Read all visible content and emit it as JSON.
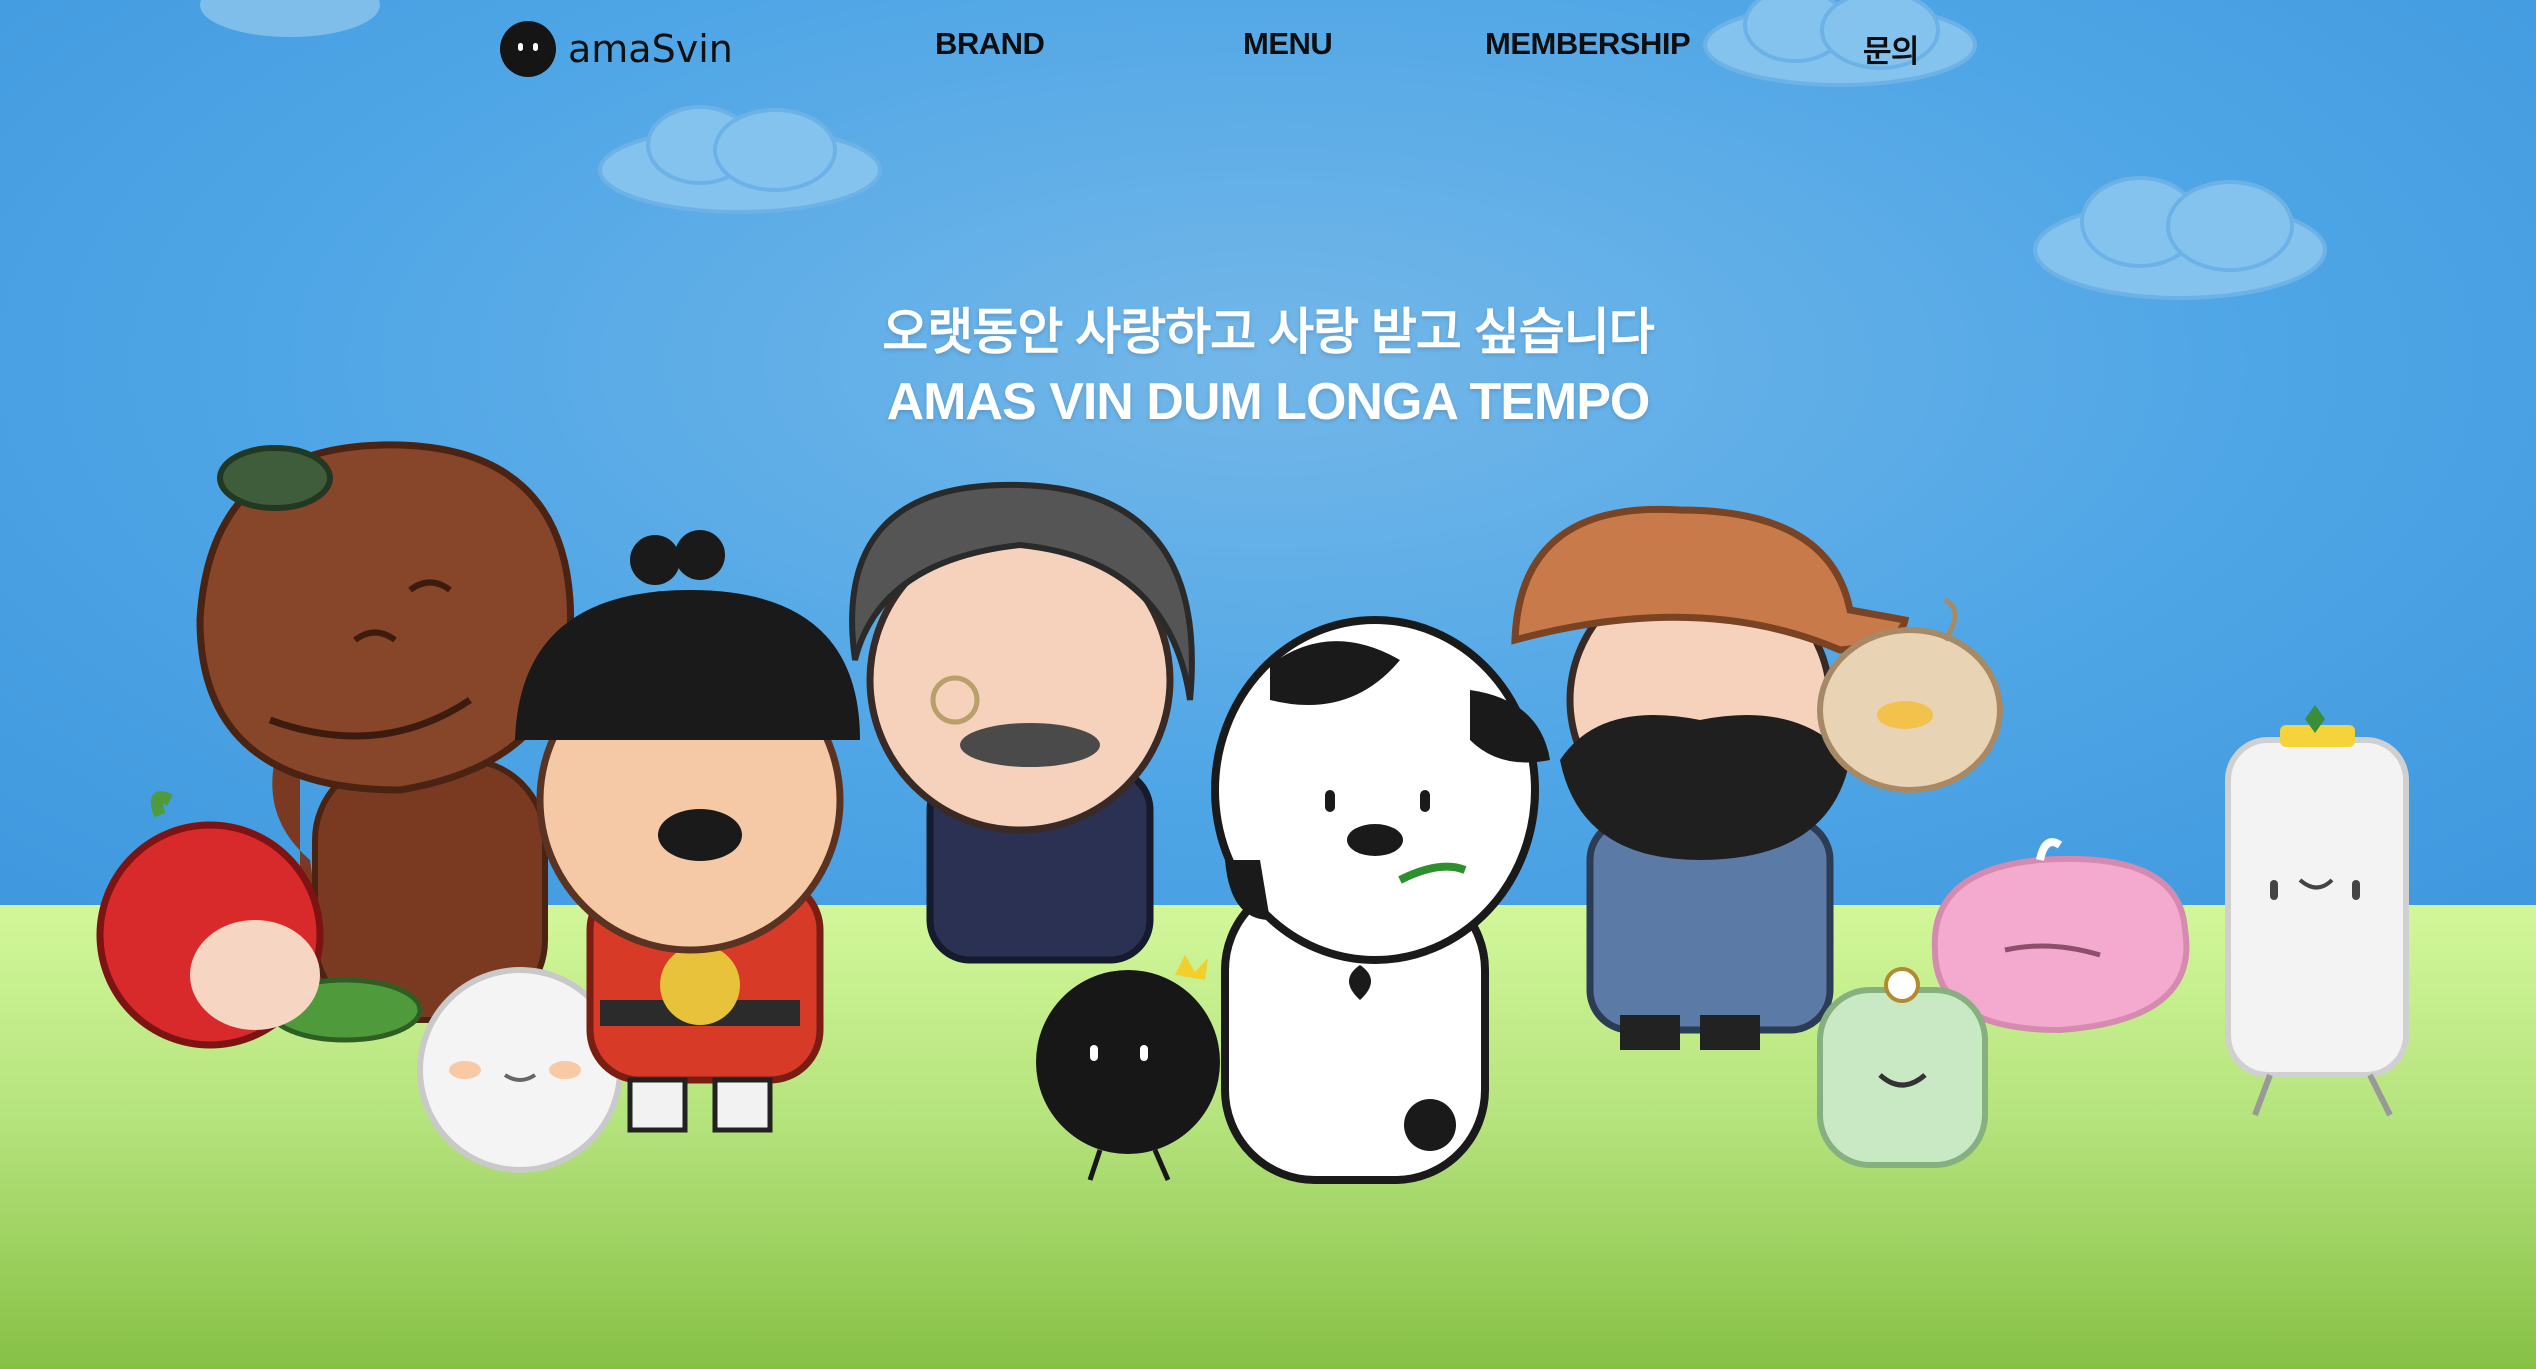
{
  "brand": {
    "logo_text": "amaSvin",
    "logo_icon": "bomb-mascot-icon"
  },
  "nav": {
    "items": [
      "BRAND",
      "MENU",
      "MEMBERSHIP",
      "문의"
    ]
  },
  "hero": {
    "title_ko": "오랫동안 사랑하고 사랑 받고 싶습니다",
    "title_la": "AMAS VIN DUM LONGA TEMPO"
  },
  "colors": {
    "sky": "#4fa6e6",
    "grass": "#b6e47e",
    "nav_text": "#0e0e10",
    "hero_text": "#ffffff"
  },
  "characters": [
    "apple-character",
    "chestnut-character",
    "king-character",
    "rice-cake-character",
    "gentleman-character",
    "bomb-character",
    "cow-character",
    "farmer-character",
    "chick-character",
    "jelly-character",
    "mint-character",
    "milk-bottle-character"
  ]
}
